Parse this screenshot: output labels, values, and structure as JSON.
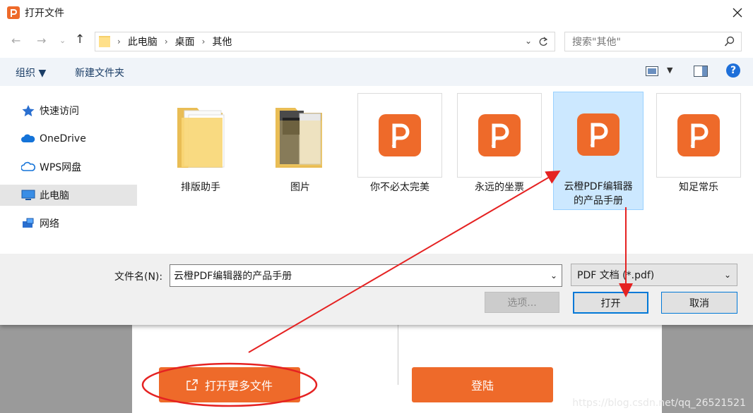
{
  "dialog": {
    "title": "打开文件",
    "breadcrumb": [
      "此电脑",
      "桌面",
      "其他"
    ],
    "search_placeholder": "搜索\"其他\"",
    "toolbar": {
      "organize": "组织 ▼",
      "new_folder": "新建文件夹"
    },
    "sidebar": [
      {
        "label": "快速访问",
        "icon": "star-icon"
      },
      {
        "label": "OneDrive",
        "icon": "cloud-icon"
      },
      {
        "label": "WPS网盘",
        "icon": "cloud-outline-icon"
      },
      {
        "label": "此电脑",
        "icon": "computer-icon",
        "selected": true
      },
      {
        "label": "网络",
        "icon": "network-icon"
      }
    ],
    "files": [
      {
        "name": "排版助手",
        "type": "folder"
      },
      {
        "name": "图片",
        "type": "folder"
      },
      {
        "name": "你不必太完美",
        "type": "pdf"
      },
      {
        "name": "永远的坐票",
        "type": "pdf"
      },
      {
        "name": "云橙PDF编辑器的产品手册",
        "name_line1": "云橙PDF编辑器",
        "name_line2": "的产品手册",
        "type": "pdf",
        "selected": true
      },
      {
        "name": "知足常乐",
        "type": "pdf"
      }
    ],
    "filename_label": "文件名(N):",
    "filename_value": "云橙PDF编辑器的产品手册",
    "filetype_value": "PDF 文档 (*.pdf)",
    "buttons": {
      "options": "选项...",
      "open": "打开",
      "cancel": "取消"
    }
  },
  "background": {
    "open_more": "打开更多文件",
    "login": "登陆",
    "watermark": "https://blog.csdn.net/qq_26521521"
  },
  "colors": {
    "accent": "#ee6a2a",
    "selection": "#cce8ff",
    "annotation": "#e52222"
  }
}
